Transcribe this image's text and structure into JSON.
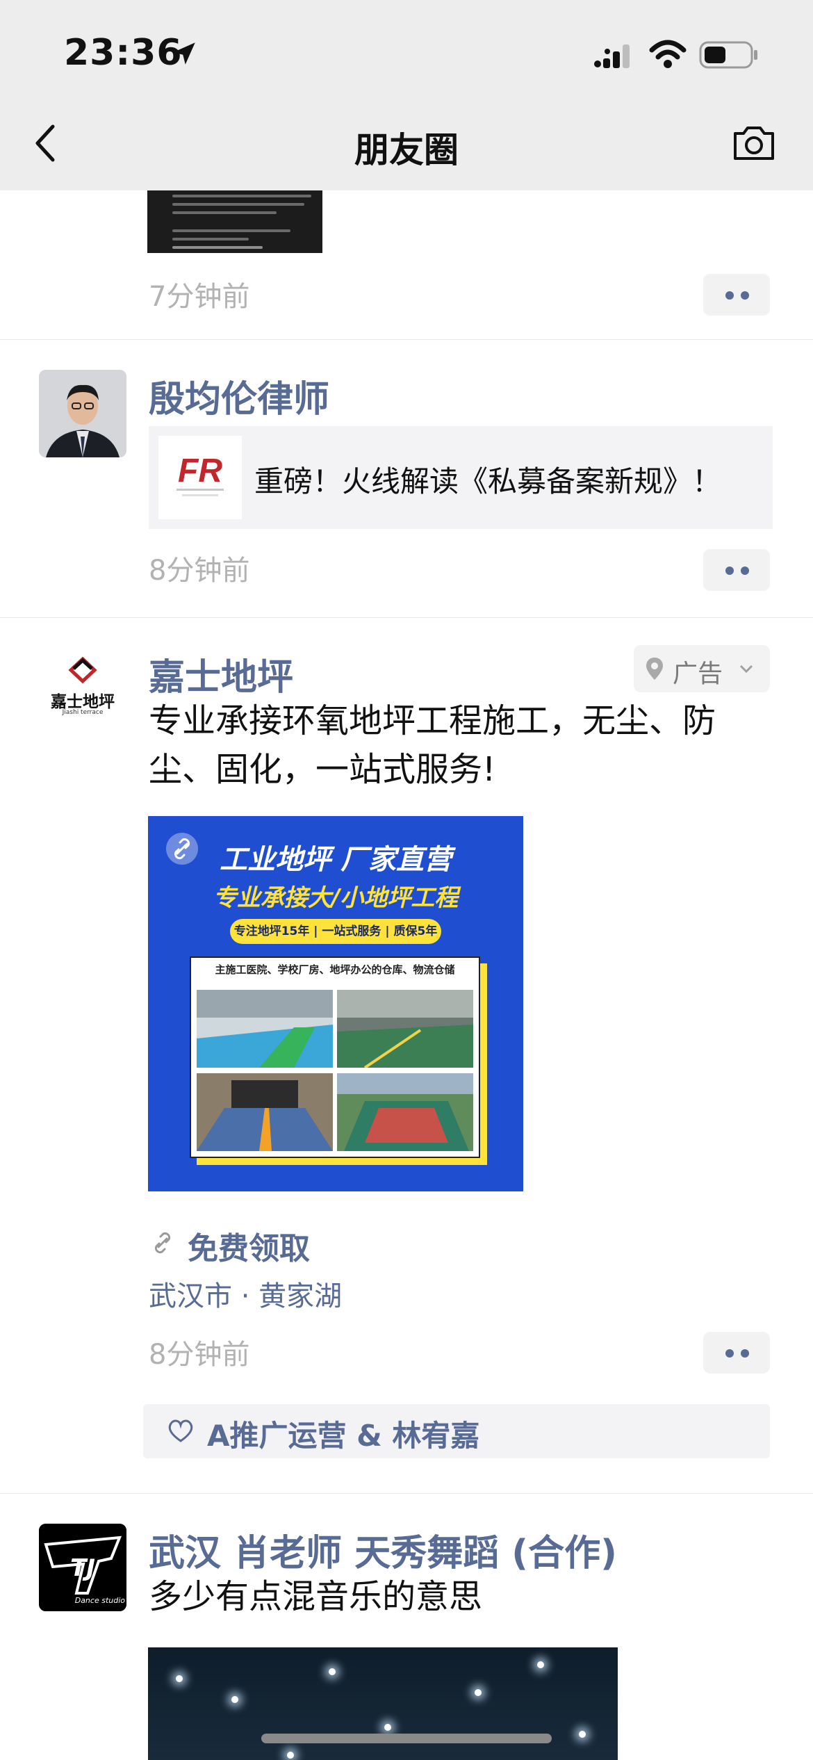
{
  "status_bar": {
    "time": "23:36"
  },
  "nav": {
    "title": "朋友圈"
  },
  "posts": [
    {
      "time": "7分钟前"
    },
    {
      "author": "殷均伦律师",
      "link_title": "重磅！火线解读《私募备案新规》！",
      "link_logo_text": "FR",
      "time": "8分钟前"
    },
    {
      "author": "嘉士地坪",
      "avatar_text": "嘉士地坪",
      "avatar_subtext": "Jiashi terrace",
      "ad_label": "广告",
      "text": "专业承接环氧地坪工程施工，无尘、防尘、固化，一站式服务!",
      "image": {
        "headline": "工业地坪  厂家直营",
        "subheadline": "专业承接大/小地坪工程",
        "pill": "专注地坪15年 | 一站式服务 | 质保5年",
        "frame_title": "主施工医院、学校厂房、地坪办公的仓库、物流仓储"
      },
      "cta": "免费领取",
      "location": "武汉市 · 黄家湖",
      "time": "8分钟前",
      "likes": "A推广运营 & 林宥嘉"
    },
    {
      "author": "武汉 肖老师 天秀舞蹈 (合作)",
      "avatar_text": "TJ",
      "avatar_subtext": "Dance studio",
      "text": "多少有点混音乐的意思"
    }
  ],
  "colors": {
    "link_blue": "#586b94",
    "nav_bg": "#ededed",
    "time_gray": "#b2b2b2"
  }
}
